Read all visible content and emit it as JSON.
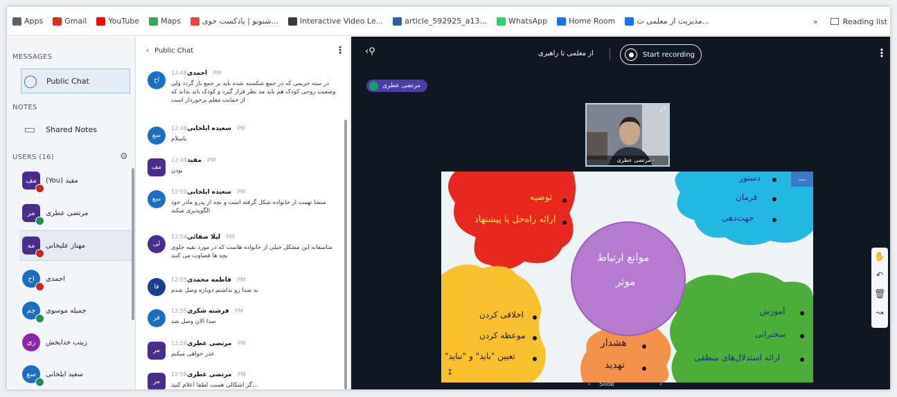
{
  "bookmarks": [
    {
      "label": "Apps",
      "color": "#5f6368"
    },
    {
      "label": "Gmail",
      "color": "#d93025"
    },
    {
      "label": "YouTube",
      "color": "#ff0000"
    },
    {
      "label": "Maps",
      "color": "#34a853"
    },
    {
      "label": "شنوتو | پادکست خوی...",
      "color": "#e8453c"
    },
    {
      "label": "Interactive Video Le...",
      "color": "#3b3b3b"
    },
    {
      "label": "article_592925_a13...",
      "color": "#2b5ea7"
    },
    {
      "label": "WhatsApp",
      "color": "#25d366"
    },
    {
      "label": "Home Room",
      "color": "#1a73e8"
    },
    {
      "label": "مدیریت از معلمی ت...",
      "color": "#1a73e8"
    }
  ],
  "bookmarks_more": "»",
  "reading_list": "Reading list",
  "sidebar": {
    "messages_title": "MESSAGES",
    "public_chat": "Public Chat",
    "notes_title": "NOTES",
    "shared_notes": "Shared Notes",
    "users_title": "USERS (16)",
    "users": [
      {
        "initials": "مف",
        "name": "مفید (You)",
        "color": "#4a2c8f",
        "mic": "#c62828",
        "shape": "square"
      },
      {
        "initials": "مر",
        "name": "مرتضی عطری",
        "color": "#4a2c8f",
        "mic": "#1e8e5a",
        "shape": "square"
      },
      {
        "initials": "مه",
        "name": "مهناز علیخانی",
        "color": "#4a2c8f",
        "mic": "#c62828",
        "shape": "square"
      },
      {
        "initials": "اح",
        "name": "احمدی",
        "color": "#1b6fc2",
        "mic": "#c62828",
        "shape": "round"
      },
      {
        "initials": "جم",
        "name": "جمیله موسوی",
        "color": "#1b6fc2",
        "mic": "#1e8e5a",
        "shape": "round"
      },
      {
        "initials": "زی",
        "name": "زینب خدابخش",
        "color": "#8e24aa",
        "mic": "",
        "shape": "round"
      },
      {
        "initials": "سع",
        "name": "سعید ایلخانی",
        "color": "#1b6fc2",
        "mic": "#1e8e5a",
        "shape": "round"
      }
    ]
  },
  "chat": {
    "title": "Public Chat",
    "messages": [
      {
        "initials": "اح",
        "name": "احمدی",
        "time": "12:48 PM",
        "color": "#1b6fc2",
        "shape": "round",
        "text": "در سته حریمی که در جمع شکسته شده باید بر جمع باز گردد ولی وضعیت روحی کودک هم باید مد نظر قرار گیرد و کودک باید بداند که از حمایت معلم برخوردار است"
      },
      {
        "initials": "سع",
        "name": "سعیده ایلخانی",
        "time": "12:48 PM",
        "color": "#1b6fc2",
        "shape": "round",
        "text": "باسلام"
      },
      {
        "initials": "مف",
        "name": "مفید",
        "time": "12:49 PM",
        "color": "#4a2c8f",
        "shape": "square",
        "text": "بودن"
      },
      {
        "initials": "سع",
        "name": "سعیده ایلخانی",
        "time": "12:50 PM",
        "color": "#1b6fc2",
        "shape": "round",
        "text": "منشا تهمت از خانواده شکل گرفته است و بچه از پدرو مادر خود الگوپذیری میکند"
      },
      {
        "initials": "لی",
        "name": "لیلا صفائی",
        "time": "12:54 PM",
        "color": "#4a2c8f",
        "shape": "round",
        "text": "متاسفانه این مشکل خیلی از خانواده هاست که در مورد بقیه جلوی بچه ها قضاوت می کنند"
      },
      {
        "initials": "فا",
        "name": "فاطمه محمدی",
        "time": "12:55 PM",
        "color": "#1b3f8f",
        "shape": "round",
        "text": "نه صدا رو نداشتم دوباره وصل شدم"
      },
      {
        "initials": "فر",
        "name": "فرشته شکری",
        "time": "12:55 PM",
        "color": "#1b6fc2",
        "shape": "round",
        "text": "صدا الان وصل شد"
      },
      {
        "initials": "مر",
        "name": "مرتضی عطری",
        "time": "12:56 PM",
        "color": "#4a2c8f",
        "shape": "square",
        "text": "عذر خواهی میکنم"
      },
      {
        "initials": "مر",
        "name": "مرتضی عطری",
        "time": "12:56 PM",
        "color": "#4a2c8f",
        "shape": "square",
        "text": "...گر اشکالی هست لطفا اعلام کنید"
      }
    ]
  },
  "stage": {
    "presenter_title": "از معلمی تا راهبری",
    "record_label": "Start recording",
    "talker_name": "مرتضی عطری",
    "webcam_label": "- مرتضی عطری"
  },
  "slide": {
    "center_title_line1": "موانع ارتباط",
    "center_title_line2": "موثر",
    "red_items": [
      "توصیه",
      "ارائه راه‌حل یا پیشنهاد"
    ],
    "blue_items": [
      "دستور",
      "فرمان",
      "جهت‌دهی"
    ],
    "yellow_items": [
      "اخلاقی کردن",
      "موعظه کردن",
      "تعیین \"باید\" و \"نباید\""
    ],
    "orange_items": [
      "هشدار",
      "تهدید"
    ],
    "green_items": [
      "آموزش",
      "سخنرانی",
      "ارائه استدلال‌های منطقی"
    ],
    "colors": {
      "red": "#e8271f",
      "blue": "#23b8e0",
      "yellow": "#fbc02d",
      "orange": "#f5924a",
      "green": "#4caf3a",
      "circle": "#b57bd0"
    },
    "footer_label": "Slide"
  }
}
